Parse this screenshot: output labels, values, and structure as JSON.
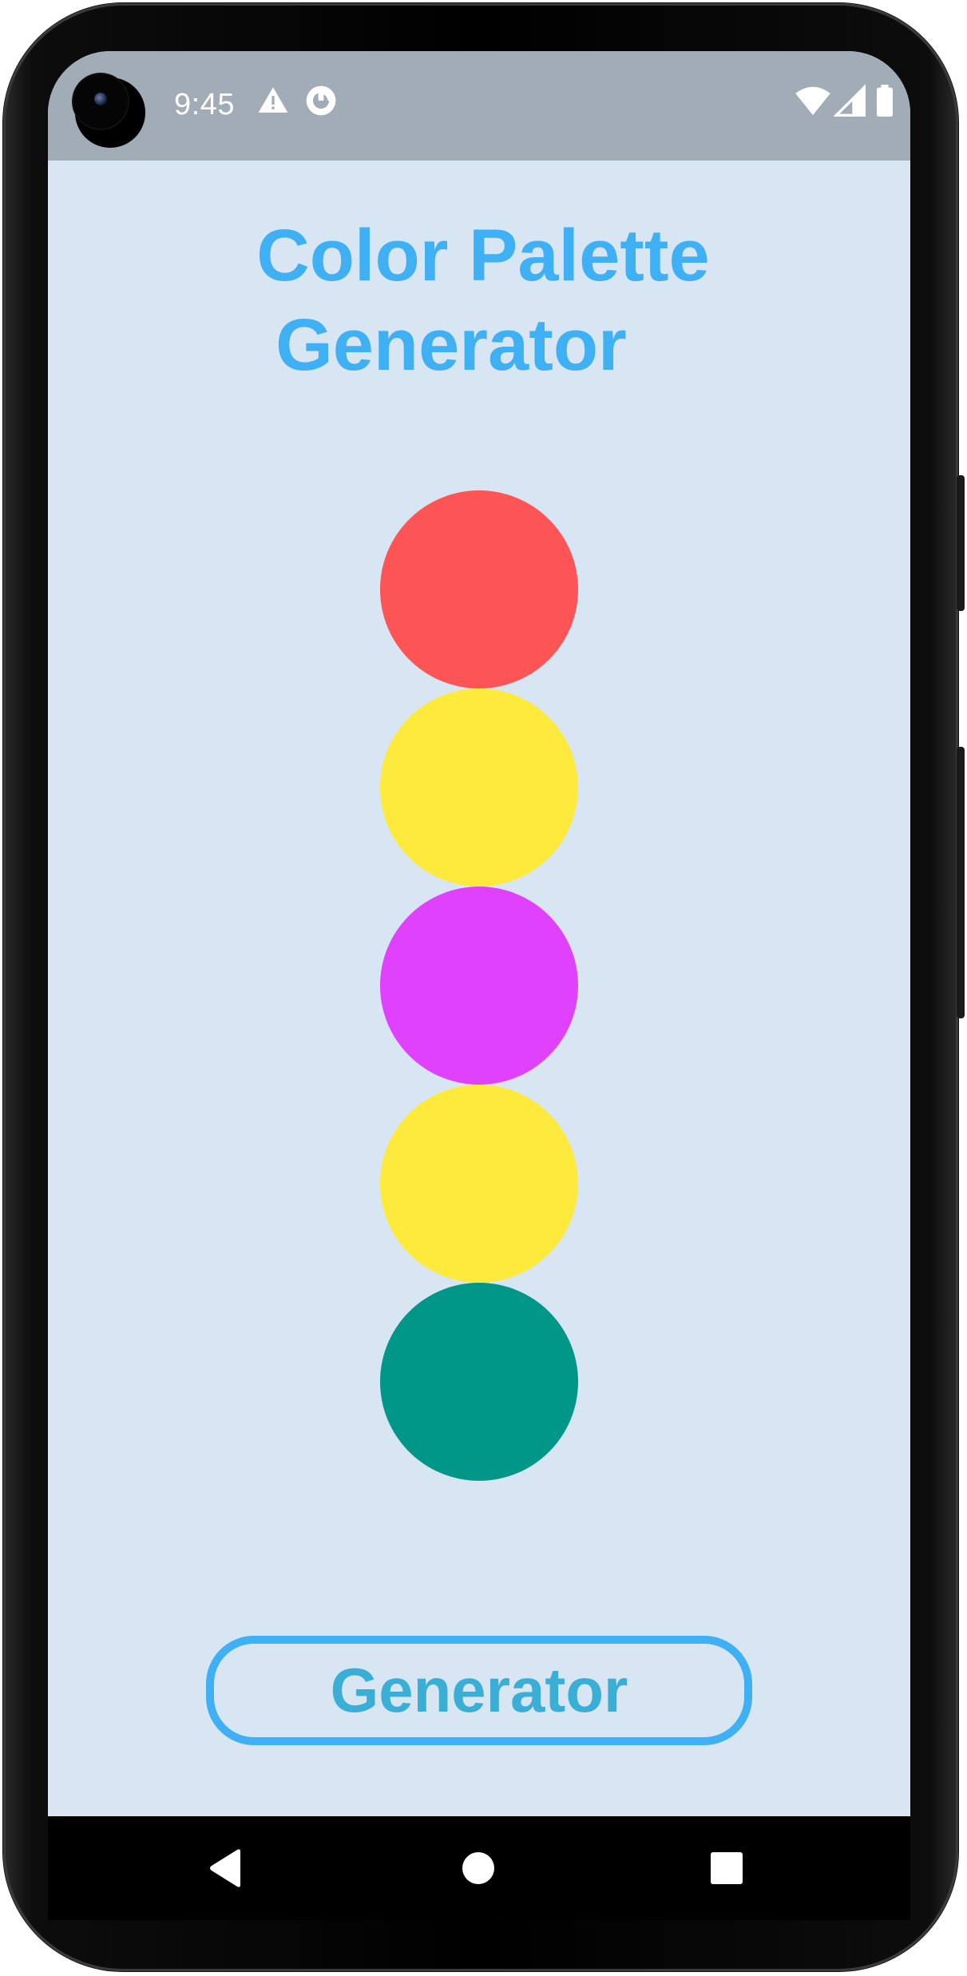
{
  "status_bar": {
    "time": "9:45",
    "icons": [
      "camera-cutout",
      "alert-icon",
      "data-saver-icon",
      "wifi-icon",
      "signal-icon",
      "battery-icon"
    ]
  },
  "app": {
    "title_line1": "Color Palette",
    "title_line2": "Generator",
    "title_color": "#3fb0f3",
    "background_color": "#d8e5f2"
  },
  "palette": {
    "swatches": [
      {
        "color": "#fd5456"
      },
      {
        "color": "#fdea3c"
      },
      {
        "color": "#e041fc"
      },
      {
        "color": "#fdea3c"
      },
      {
        "color": "#009688"
      }
    ]
  },
  "generate_button": {
    "label": "Generator",
    "border_color": "#3fb0f3"
  },
  "navigation": {
    "buttons": [
      "back-icon",
      "home-icon",
      "recents-icon"
    ]
  }
}
